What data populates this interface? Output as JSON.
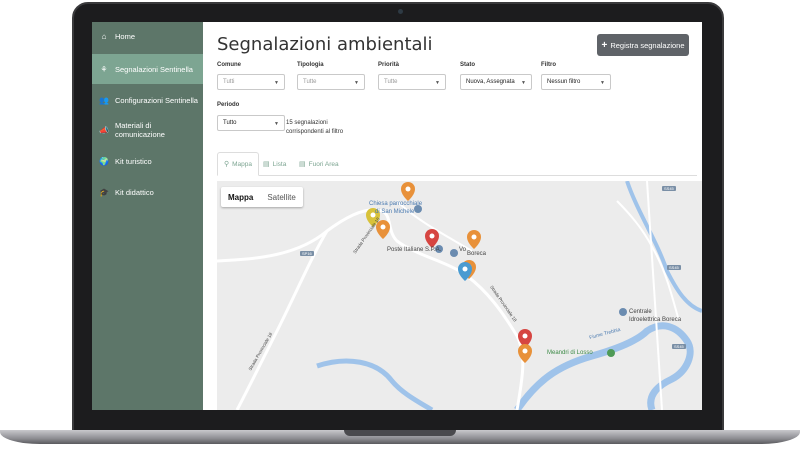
{
  "sidebar": {
    "items": [
      {
        "label": "Home",
        "icon": "home-icon"
      },
      {
        "label": "Segnalazioni Sentinella",
        "icon": "seedling-icon",
        "active": true
      },
      {
        "label": "Configurazioni Sentinella",
        "icon": "users-icon"
      },
      {
        "label": "Materiali di comunicazione",
        "icon": "megaphone-icon"
      },
      {
        "label": "Kit turistico",
        "icon": "globe-icon"
      },
      {
        "label": "Kit didattico",
        "icon": "graduation-cap-icon"
      }
    ]
  },
  "header": {
    "title": "Segnalazioni ambientali",
    "add_button": "Registra segnalazione"
  },
  "filters": {
    "comune": {
      "label": "Comune",
      "value": "Tutti"
    },
    "tipologia": {
      "label": "Tipologia",
      "value": "Tutte"
    },
    "priorita": {
      "label": "Priorità",
      "value": "Tutte"
    },
    "stato": {
      "label": "Stato",
      "value": "Nuova, Assegnata"
    },
    "filtro": {
      "label": "Filtro",
      "value": "Nessun filtro"
    },
    "periodo": {
      "label": "Periodo",
      "value": "Tutto"
    }
  },
  "result_count": {
    "line1": "15 segnalazioni",
    "line2": "corrispondenti al filtro"
  },
  "tabs": [
    {
      "label": "Mappa",
      "icon": "map-marker-icon",
      "active": true
    },
    {
      "label": "Lista",
      "icon": "list-icon"
    },
    {
      "label": "Fuori Area",
      "icon": "list-icon"
    }
  ],
  "map": {
    "type_buttons": [
      "Mappa",
      "Satellite"
    ],
    "labels": {
      "chiesa1": "Chiesa parrocchiale",
      "chiesa2": "di San Michele",
      "poste": "Poste Italiane S.P.A.",
      "vo": "Vo",
      "boreca": "Boreca",
      "centrale1": "Centrale",
      "centrale2": "Idroelettrica Boreca",
      "meandri": "Meandri di Losso",
      "fiume": "Fiume Trebbia",
      "strada1": "Strada Provinciale 18",
      "strada2": "Strada Provinciale 18",
      "strada3": "Strada Provinciale 18",
      "sp": "SP16",
      "s45a": "SS45",
      "s45b": "SS45",
      "s45c": "SS45"
    }
  },
  "colors": {
    "sidebar_bg": "#5d7669",
    "sidebar_active": "#7da592",
    "accent": "#7da592",
    "pin_orange": "#e8913a",
    "pin_red": "#d64541",
    "pin_blue": "#4a9bd1",
    "pin_yellow": "#d8c23a",
    "river": "#9fc3ea"
  }
}
